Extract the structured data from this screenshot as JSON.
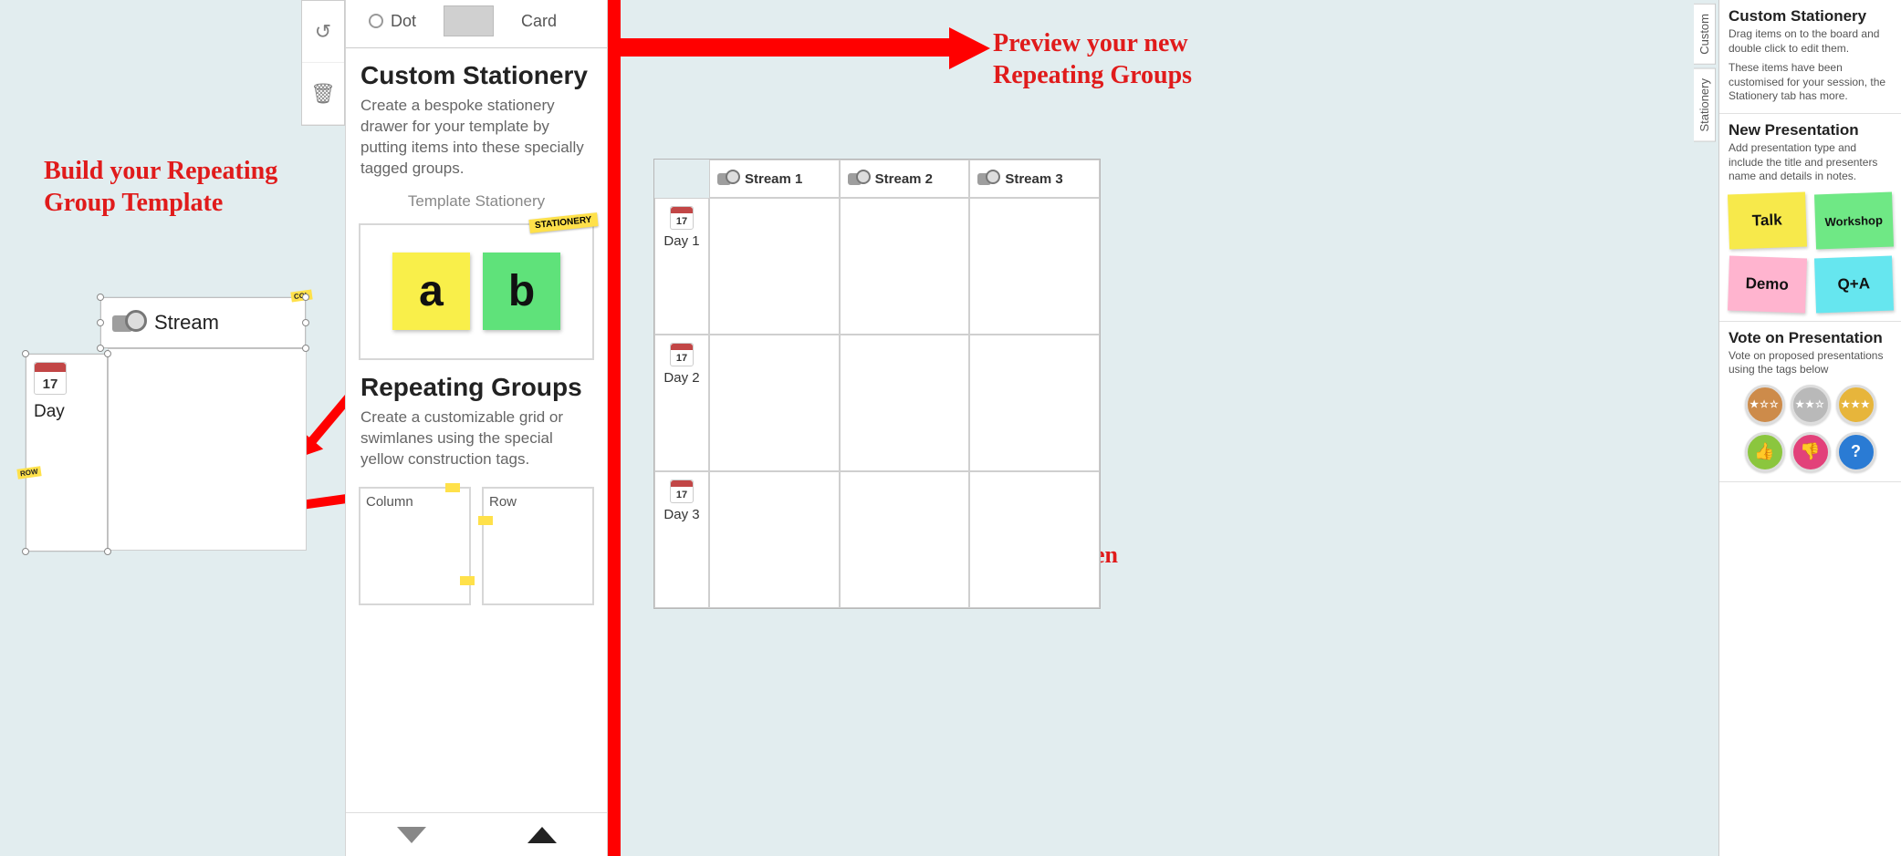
{
  "annotations": {
    "left": "Build your Repeating Group Template",
    "rightT": "Preview your new Repeating Groups",
    "center": "Number of Rows and Columns set by user when creating Board"
  },
  "toolbar": {
    "undo_tip": "Undo",
    "trash_tip": "Delete"
  },
  "editor": {
    "opt_dot": "Dot",
    "opt_card": "Card",
    "section1": {
      "title": "Custom Stationery",
      "body": "Create a bespoke stationery drawer for your template by putting items into these specially tagged groups.",
      "sub": "Template Stationery",
      "tag": "STATIONERY",
      "sticky_a": "a",
      "sticky_b": "b"
    },
    "section2": {
      "title": "Repeating Groups",
      "body": "Create a customizable grid or swimlanes using the special yellow construction tags.",
      "column": "Column",
      "row": "Row"
    }
  },
  "template": {
    "stream_label": "Stream",
    "day_label": "Day",
    "day_num": "17",
    "col_tag": "COL",
    "row_tag": "ROW"
  },
  "preview": {
    "cols": [
      "Stream 1",
      "Stream 2",
      "Stream 3"
    ],
    "rows": [
      "Day 1",
      "Day 2",
      "Day 3"
    ],
    "day_num": "17"
  },
  "rail": {
    "tab_custom": "Custom",
    "tab_stationery": "Stationery",
    "sec1": {
      "title": "Custom Stationery",
      "p1": "Drag items on to the board and double click to edit them.",
      "p2": "These items have been customised for your session, the Stationery tab has more."
    },
    "sec2": {
      "title": "New Presentation",
      "p": "Add presentation type and include the title and presenters name and details in notes.",
      "notes": {
        "talk": "Talk",
        "ws": "Workshop",
        "demo": "Demo",
        "qa": "Q+A"
      }
    },
    "sec3": {
      "title": "Vote on Presentation",
      "p": "Vote on proposed presentations using the tags below",
      "star1": "★☆☆",
      "star2": "★★☆",
      "star3": "★★★",
      "thumbs_up": "👍",
      "thumbs_down": "👎",
      "question": "?"
    }
  }
}
